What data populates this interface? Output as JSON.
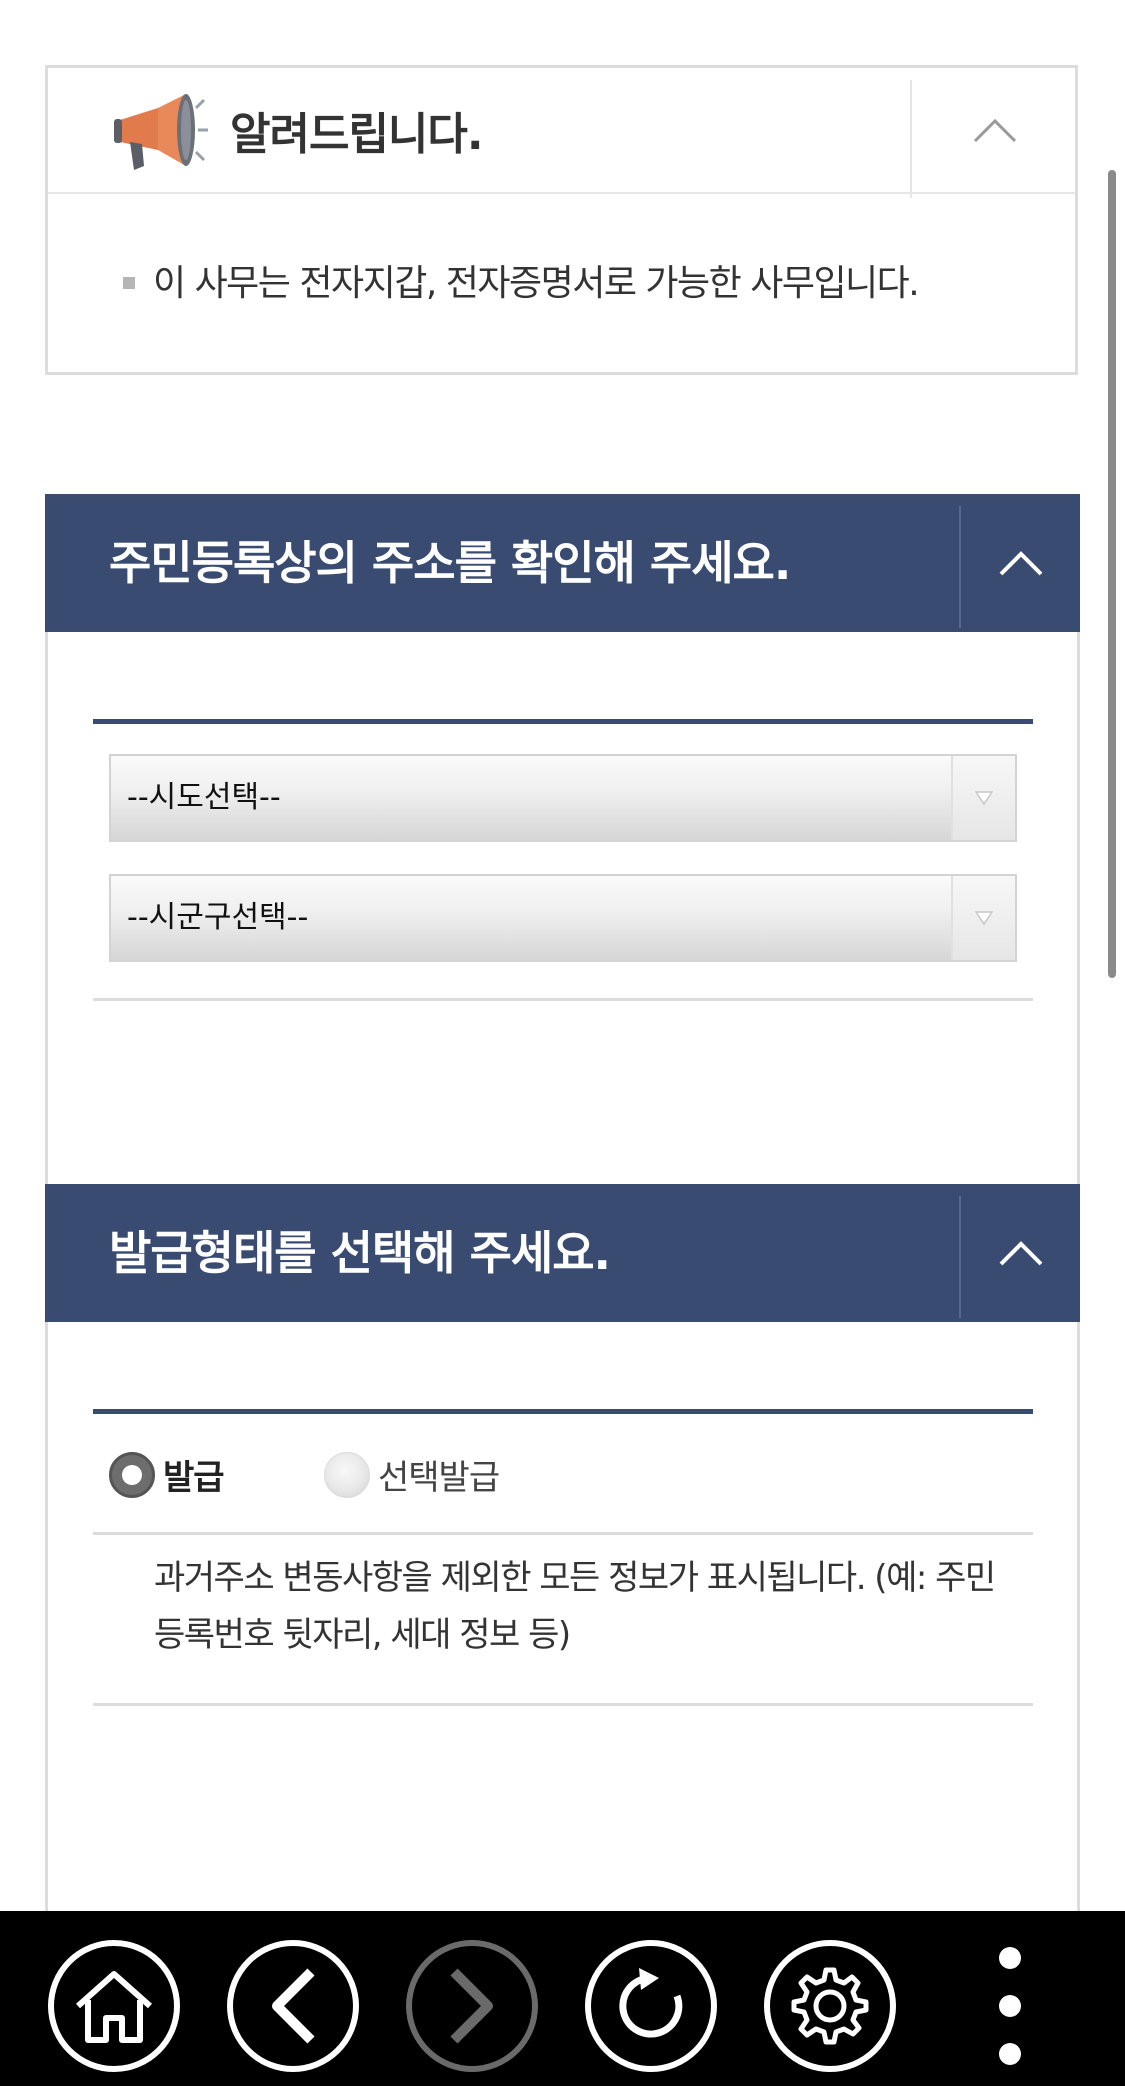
{
  "notice": {
    "title": "알려드립니다.",
    "message": "이 사무는 전자지갑, 전자증명서로 가능한 사무입니다."
  },
  "address_section": {
    "title": "주민등록상의 주소를 확인해 주세요.",
    "sido_select": "--시도선택--",
    "sigungu_select": "--시군구선택--"
  },
  "issue_section": {
    "title": "발급형태를 선택해 주세요.",
    "options": [
      {
        "label": "발급",
        "selected": true
      },
      {
        "label": "선택발급",
        "selected": false
      }
    ],
    "description": "과거주소 변동사항을 제외한 모든 정보가 표시됩니다. (예: 주민등록번호 뒷자리, 세대 정보 등)"
  },
  "navbar": {
    "buttons": [
      "home-icon",
      "back-icon",
      "forward-icon",
      "refresh-icon",
      "settings-icon",
      "more-icon"
    ],
    "forward_enabled": false
  },
  "colors": {
    "header_bar": "#3a4b72",
    "megaphone": "#e27b4b",
    "navbar_bg": "#000000"
  }
}
